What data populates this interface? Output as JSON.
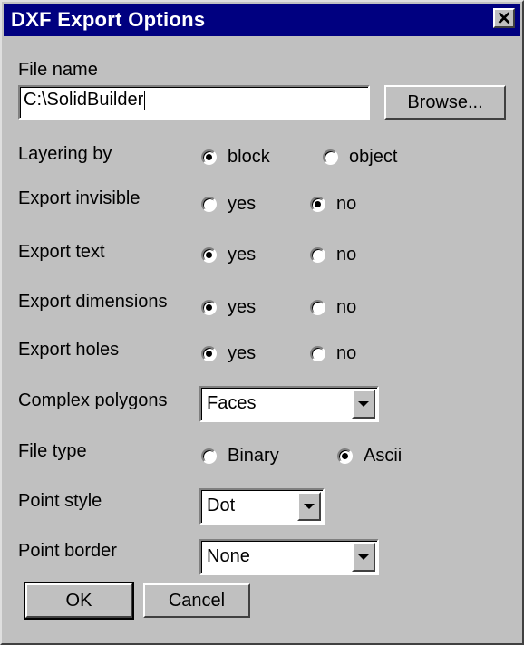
{
  "window": {
    "title": "DXF Export Options",
    "close_glyph": "✕"
  },
  "file": {
    "label": "File name",
    "value": "C:\\SolidBuilder",
    "browse": "Browse..."
  },
  "layering": {
    "label": "Layering by",
    "opt1": "block",
    "opt2": "object",
    "selected": "block"
  },
  "invisible": {
    "label": "Export invisible",
    "opt1": "yes",
    "opt2": "no",
    "selected": "no"
  },
  "text": {
    "label": "Export text",
    "opt1": "yes",
    "opt2": "no",
    "selected": "yes"
  },
  "dimensions": {
    "label": "Export dimensions",
    "opt1": "yes",
    "opt2": "no",
    "selected": "yes"
  },
  "holes": {
    "label": "Export holes",
    "opt1": "yes",
    "opt2": "no",
    "selected": "yes"
  },
  "complex": {
    "label": "Complex polygons",
    "value": "Faces"
  },
  "filetype": {
    "label": "File type",
    "opt1": "Binary",
    "opt2": "Ascii",
    "selected": "Ascii"
  },
  "pointstyle": {
    "label": "Point style",
    "value": "Dot"
  },
  "pointborder": {
    "label": "Point border",
    "value": "None"
  },
  "buttons": {
    "ok": "OK",
    "cancel": "Cancel"
  }
}
